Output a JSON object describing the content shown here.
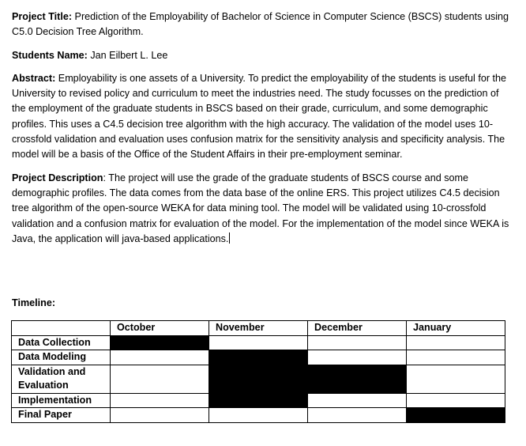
{
  "project_title": {
    "label": "Project Title:",
    "text": " Prediction of the Employability of Bachelor of Science in Computer Science (BSCS) students using C5.0 Decision Tree Algorithm."
  },
  "students_name": {
    "label": "Students Name:",
    "text": " Jan Eilbert L. Lee"
  },
  "abstract": {
    "label": "Abstract:",
    "text": " Employability is one assets of a University. To predict the employability of the students is useful for the University to revised policy and curriculum to meet the industries need. The study focusses on the prediction of the employment of the graduate students in BSCS based on their grade, curriculum, and some demographic profiles. This uses a C4.5 decision tree algorithm with the high accuracy. The validation of the model uses 10-crossfold validation and evaluation uses confusion matrix for the sensitivity analysis and specificity analysis. The model will be a basis of the Office of the Student Affairs in their pre-employment seminar."
  },
  "project_description": {
    "label": "Project Description",
    "text": ": The project will use the grade of the graduate students of BSCS course and some demographic profiles. The data comes from the data base of the online ERS. This project utilizes C4.5 decision tree algorithm of the open-source WEKA for data mining tool. The model will be validated using 10-crossfold validation and a confusion matrix for evaluation of the model. For the implementation of the model since WEKA is Java, the application will java-based applications."
  },
  "timeline": {
    "label": "Timeline:",
    "months": [
      "October",
      "November",
      "December",
      "January"
    ],
    "rows": [
      {
        "task": "Data Collection",
        "active": [
          true,
          false,
          false,
          false
        ]
      },
      {
        "task": "Data Modeling",
        "active": [
          false,
          true,
          false,
          false
        ]
      },
      {
        "task": "Validation and Evaluation",
        "active": [
          false,
          true,
          true,
          false
        ]
      },
      {
        "task": "Implementation",
        "active": [
          false,
          true,
          false,
          false
        ]
      },
      {
        "task": "Final Paper",
        "active": [
          false,
          false,
          false,
          true
        ]
      }
    ]
  }
}
